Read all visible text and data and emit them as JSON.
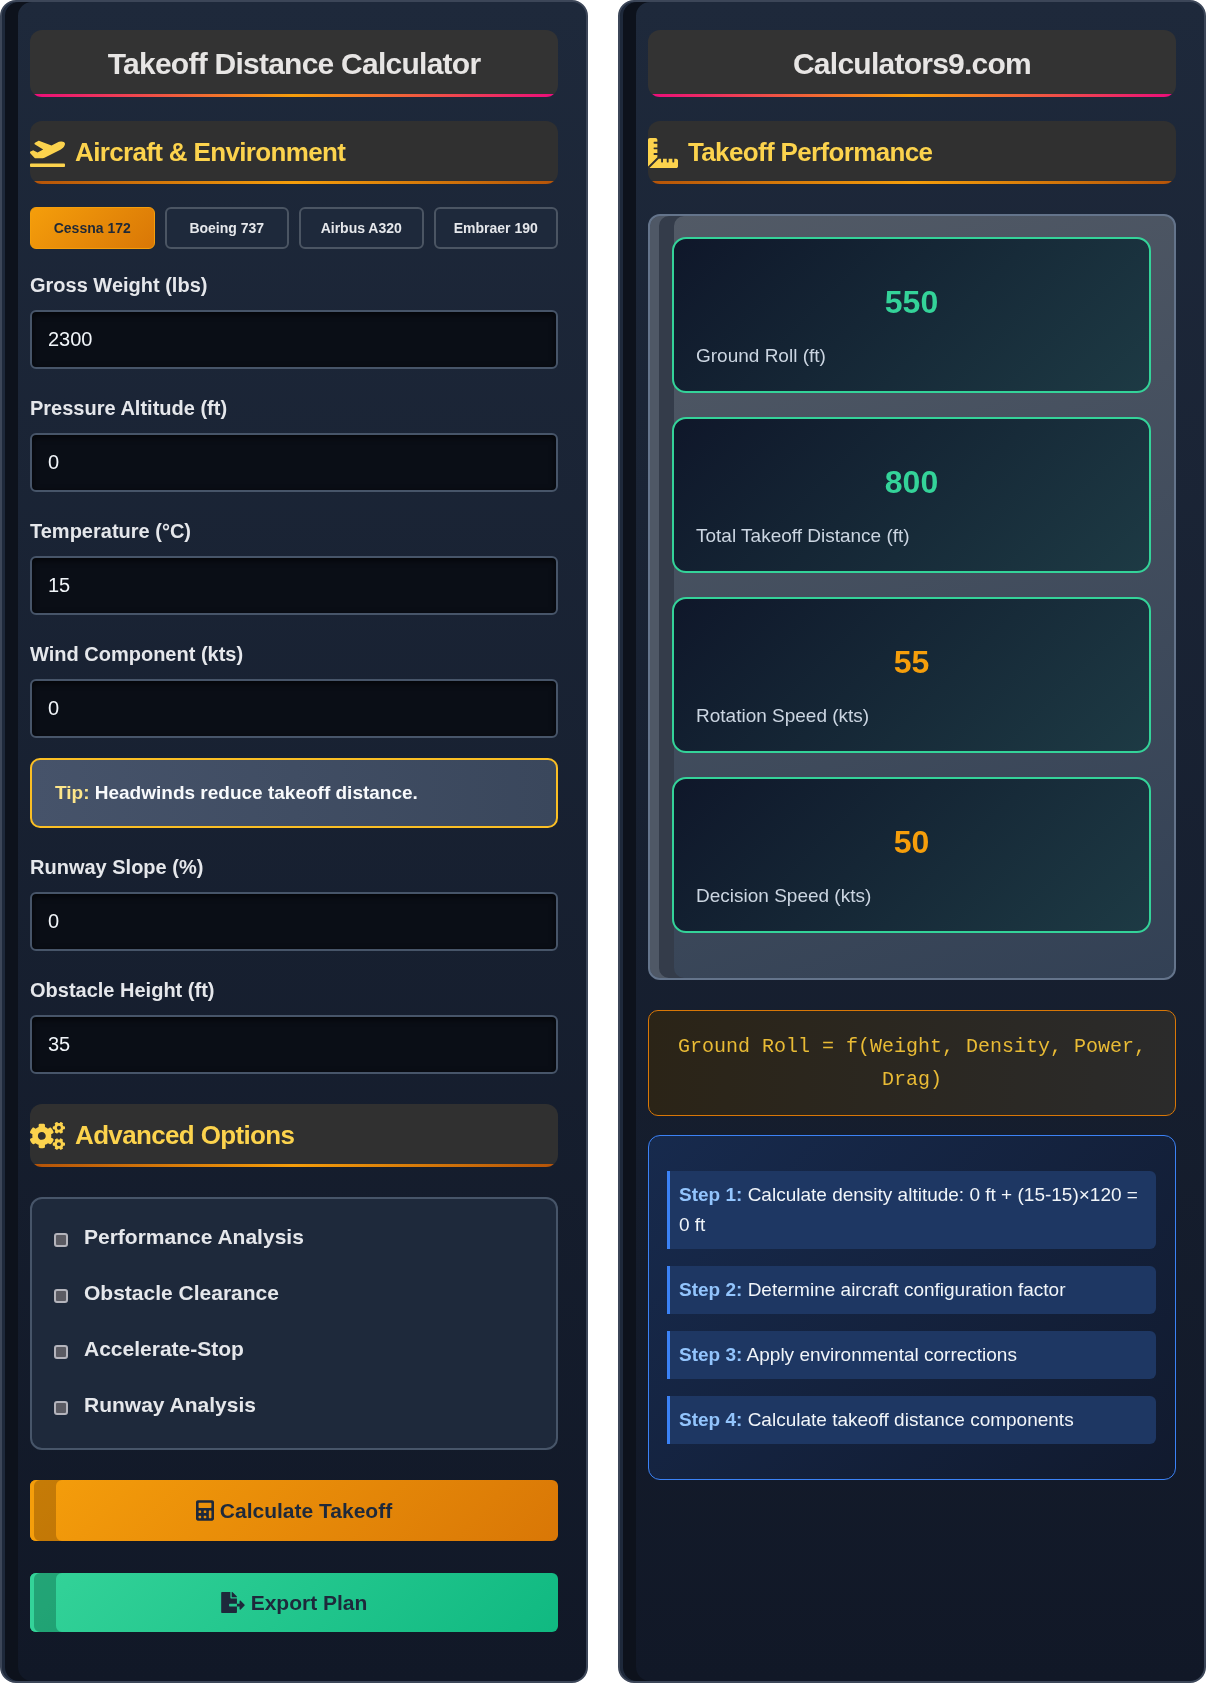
{
  "calculator_panel": {
    "title": "Takeoff Distance Calculator",
    "section_heading": "Aircraft & Environment",
    "aircraft_presets": [
      {
        "label": "Cessna 172",
        "selected": true
      },
      {
        "label": "Boeing 737",
        "selected": false
      },
      {
        "label": "Airbus A320",
        "selected": false
      },
      {
        "label": "Embraer 190",
        "selected": false
      }
    ],
    "fields": [
      {
        "kind": "input",
        "label": "Gross Weight (lbs)",
        "value": "2300"
      },
      {
        "kind": "input",
        "label": "Pressure Altitude (ft)",
        "value": "0"
      },
      {
        "kind": "input",
        "label": "Temperature (°C)",
        "value": "15"
      },
      {
        "kind": "input",
        "label": "Wind Component (kts)",
        "value": "0"
      },
      {
        "kind": "tip",
        "text": "**Tip:** Headwinds reduce takeoff distance."
      },
      {
        "kind": "input",
        "label": "Runway Slope (%)",
        "value": "0"
      },
      {
        "kind": "input",
        "label": "Obstacle Height (ft)",
        "value": "35"
      }
    ],
    "advanced_heading": "Advanced Options",
    "advanced_options": [
      {
        "label": "Performance Analysis",
        "checked": false
      },
      {
        "label": "Obstacle Clearance",
        "checked": false
      },
      {
        "label": "Accelerate-Stop",
        "checked": false
      },
      {
        "label": "Runway Analysis",
        "checked": false
      }
    ],
    "buttons": [
      {
        "kind": "calculate",
        "label": "Calculate Takeoff"
      },
      {
        "kind": "export",
        "label": "Export Plan"
      }
    ]
  },
  "results_panel": {
    "title": "Calculators9.com",
    "section_heading": "Takeoff Performance",
    "metrics": [
      {
        "value": "550",
        "label": "Ground Roll (ft)",
        "color": "#34d399"
      },
      {
        "value": "800",
        "label": "Total Takeoff Distance (ft)",
        "color": "#34d399"
      },
      {
        "value": "55",
        "label": "Rotation Speed (kts)",
        "color": "#f59e0b"
      },
      {
        "value": "50",
        "label": "Decision Speed (kts)",
        "color": "#f59e0b"
      }
    ],
    "formula": "Ground Roll = f(Weight, Density, Power, Drag)",
    "steps": [
      "**Step 1:** Calculate density altitude: 0 ft + (15-15)×120 = 0 ft",
      "**Step 2:** Determine aircraft configuration factor",
      "**Step 3:** Apply environmental corrections",
      "**Step 4:** Calculate takeoff distance components"
    ]
  }
}
